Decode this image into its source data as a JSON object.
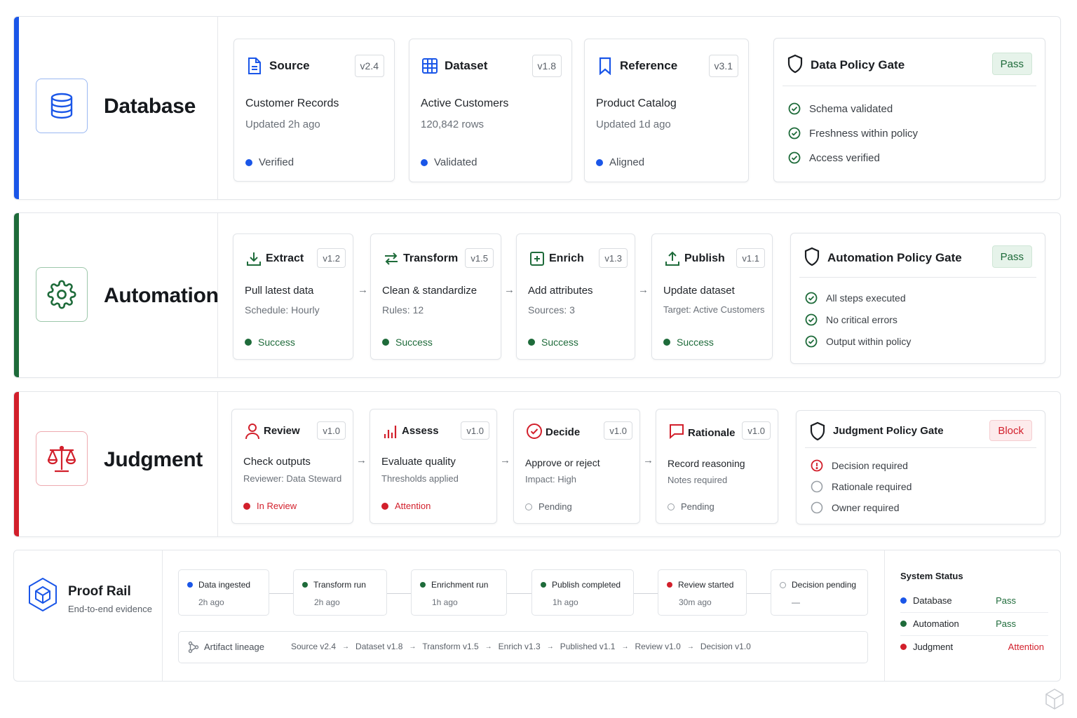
{
  "colors": {
    "blue": "#1a56e8",
    "green": "#1e6b3a",
    "red": "#d21f2b",
    "gray_ring": "#9aa0a6",
    "pass_bg": "#e6f3ea",
    "block_bg": "#fdebec"
  },
  "database": {
    "title": "Database",
    "icon": "database-icon",
    "cards": [
      {
        "icon": "file-icon",
        "title": "Source",
        "version": "v2.4",
        "main": "Customer Records",
        "sub": "Updated 2h ago",
        "status": "Verified"
      },
      {
        "icon": "grid-icon",
        "title": "Dataset",
        "version": "v1.8",
        "main": "Active Customers",
        "sub": "120,842 rows",
        "status": "Validated"
      },
      {
        "icon": "bookmark-icon",
        "title": "Reference",
        "version": "v3.1",
        "main": "Product Catalog",
        "sub": "Updated 1d ago",
        "status": "Aligned"
      }
    ],
    "gate": {
      "title": "Data Policy Gate",
      "badge": "Pass",
      "items": [
        "Schema validated",
        "Freshness within policy",
        "Access verified"
      ]
    }
  },
  "automation": {
    "title": "Automation",
    "icon": "gear-icon",
    "cards": [
      {
        "icon": "download-icon",
        "title": "Extract",
        "version": "v1.2",
        "main": "Pull latest data",
        "sub": "Schedule: Hourly",
        "status": "Success"
      },
      {
        "icon": "transform-icon",
        "title": "Transform",
        "version": "v1.5",
        "main": "Clean & standardize",
        "sub": "Rules: 12",
        "status": "Success"
      },
      {
        "icon": "plus-square-icon",
        "title": "Enrich",
        "version": "v1.3",
        "main": "Add attributes",
        "sub": "Sources: 3",
        "status": "Success"
      },
      {
        "icon": "upload-icon",
        "title": "Publish",
        "version": "v1.1",
        "main": "Update dataset",
        "sub": "Target: Active Customers",
        "status": "Success"
      }
    ],
    "arrow": "→",
    "gate": {
      "title": "Automation Policy Gate",
      "badge": "Pass",
      "items": [
        "All steps executed",
        "No critical errors",
        "Output within policy"
      ]
    }
  },
  "judgment": {
    "title": "Judgment",
    "icon": "scales-icon",
    "cards": [
      {
        "icon": "user-icon",
        "title": "Review",
        "version": "v1.0",
        "main": "Check outputs",
        "sub": "Reviewer: Data Steward",
        "status": "In Review"
      },
      {
        "icon": "bar-chart-icon",
        "title": "Assess",
        "version": "v1.0",
        "main": "Evaluate quality",
        "sub": "Thresholds applied",
        "status": "Attention"
      },
      {
        "icon": "check-circle-icon",
        "title": "Decide",
        "version": "v1.0",
        "main": "Approve or reject",
        "sub": "Impact: High",
        "status": "Pending"
      },
      {
        "icon": "message-icon",
        "title": "Rationale",
        "version": "v1.0",
        "main": "Record reasoning",
        "sub": "Notes required",
        "status": "Pending"
      }
    ],
    "gate": {
      "title": "Judgment Policy Gate",
      "badge": "Block",
      "items": [
        "Decision required",
        "Rationale required",
        "Owner required"
      ]
    }
  },
  "proof": {
    "title": "Proof Rail",
    "subtitle": "End-to-end evidence",
    "icon": "cube-icon",
    "timeline": [
      {
        "label": "Data ingested",
        "time": "2h ago",
        "dot": "blue"
      },
      {
        "label": "Transform run",
        "time": "2h ago",
        "dot": "green"
      },
      {
        "label": "Enrichment run",
        "time": "1h ago",
        "dot": "green"
      },
      {
        "label": "Publish completed",
        "time": "1h ago",
        "dot": "green"
      },
      {
        "label": "Review started",
        "time": "30m ago",
        "dot": "red"
      },
      {
        "label": "Decision pending",
        "time": "—",
        "dot": "ring"
      }
    ],
    "lineage": {
      "label": "Artifact lineage",
      "icon": "lineage-icon",
      "chain": [
        "Source v2.4",
        "Dataset v1.8",
        "Transform v1.5",
        "Enrich v1.3",
        "Published v1.1",
        "Review v1.0",
        "Decision v1.0"
      ],
      "separator": "→"
    }
  },
  "system_status": {
    "title": "System Status",
    "rows": [
      {
        "name": "Database",
        "value": "Pass",
        "dot": "blue"
      },
      {
        "name": "Automation",
        "value": "Pass",
        "dot": "green"
      },
      {
        "name": "Judgment",
        "value": "Attention",
        "dot": "red"
      }
    ]
  }
}
